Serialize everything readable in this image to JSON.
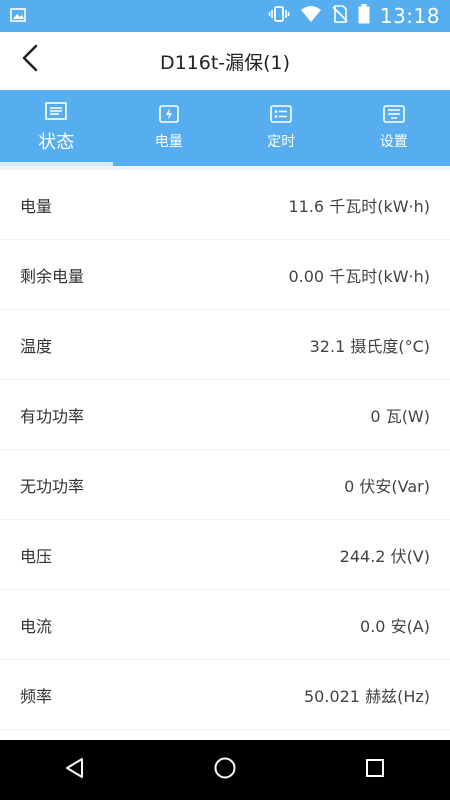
{
  "status_bar": {
    "time": "13:18",
    "icons": [
      "image-icon",
      "vibrate-icon",
      "wifi-icon",
      "no-sim-icon",
      "battery-icon"
    ]
  },
  "app_bar": {
    "title": "D116t-漏保(1)",
    "back_icon": "chevron-left-icon"
  },
  "tabs": [
    {
      "label": "状态",
      "icon": "list-icon",
      "active": true
    },
    {
      "label": "电量",
      "icon": "lightning-icon",
      "active": false
    },
    {
      "label": "定时",
      "icon": "timer-icon",
      "active": false
    },
    {
      "label": "设置",
      "icon": "settings-icon",
      "active": false
    }
  ],
  "metrics": [
    {
      "label": "电量",
      "value": "11.6 千瓦时(kW·h)"
    },
    {
      "label": "剩余电量",
      "value": "0.00 千瓦时(kW·h)"
    },
    {
      "label": "温度",
      "value": "32.1 摄氏度(°C)"
    },
    {
      "label": "有功功率",
      "value": "0 瓦(W)"
    },
    {
      "label": "无功功率",
      "value": "0 伏安(Var)"
    },
    {
      "label": "电压",
      "value": "244.2 伏(V)"
    },
    {
      "label": "电流",
      "value": "0.0 安(A)"
    },
    {
      "label": "频率",
      "value": "50.021 赫兹(Hz)"
    }
  ],
  "nav_bar": {
    "buttons": [
      "back-triangle-icon",
      "home-circle-icon",
      "recents-square-icon"
    ]
  },
  "colors": {
    "primary": "#56aef0",
    "active_underline": "#d9ecfb"
  }
}
